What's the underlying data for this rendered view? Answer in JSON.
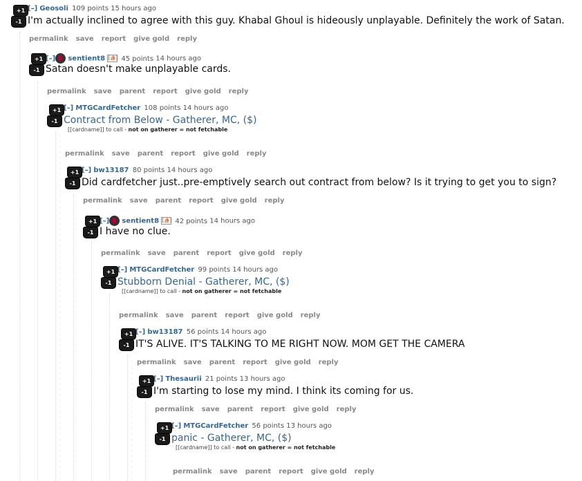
{
  "comments": [
    {
      "collapse": "[–]",
      "author": "Geosoli",
      "score": "109 points",
      "time": "15 hours ago",
      "body": "I'm actually inclined to agree with this guy. Khabal Ghoul is hideously unplayable. Definitely the work of Satan.",
      "buttons": [
        "permalink",
        "save",
        "report",
        "give gold",
        "reply"
      ]
    },
    {
      "collapse": "[–]",
      "author": "sentient8",
      "flair": "[⛵]",
      "score": "45 points",
      "time": "14 hours ago",
      "body": "Satan doesn't make unplayable cards.",
      "buttons": [
        "permalink",
        "save",
        "parent",
        "report",
        "give gold",
        "reply"
      ]
    },
    {
      "collapse": "[–]",
      "author": "MTGCardFetcher",
      "score": "108 points",
      "time": "14 hours ago",
      "card": "Contract from Below - Gatherer, MC, ($)",
      "footnote_a": "[[cardname]] to call - ",
      "footnote_b": "not on gatherer = not fetchable",
      "buttons": [
        "permalink",
        "save",
        "parent",
        "report",
        "give gold",
        "reply"
      ]
    },
    {
      "collapse": "[–]",
      "author": "bw13187",
      "score": "80 points",
      "time": "14 hours ago",
      "body": "Did cardfetcher just..pre-emptively search out contract from below? Is it trying to get you to sign?",
      "buttons": [
        "permalink",
        "save",
        "parent",
        "report",
        "give gold",
        "reply"
      ]
    },
    {
      "collapse": "[–]",
      "author": "sentient8",
      "flair": "[⛵]",
      "score": "42 points",
      "time": "14 hours ago",
      "body": "I have no clue.",
      "buttons": [
        "permalink",
        "save",
        "parent",
        "report",
        "give gold",
        "reply"
      ]
    },
    {
      "collapse": "[–]",
      "author": "MTGCardFetcher",
      "score": "99 points",
      "time": "14 hours ago",
      "card": "Stubborn Denial - Gatherer, MC, ($)",
      "footnote_a": "[[cardname]] to call - ",
      "footnote_b": "not on gatherer = not fetchable",
      "buttons": [
        "permalink",
        "save",
        "parent",
        "report",
        "give gold",
        "reply"
      ]
    },
    {
      "collapse": "[–]",
      "author": "bw13187",
      "score": "56 points",
      "time": "14 hours ago",
      "body": "IT'S ALIVE. IT'S TALKING TO ME RIGHT NOW. MOM GET THE CAMERA",
      "buttons": [
        "permalink",
        "save",
        "parent",
        "report",
        "give gold",
        "reply"
      ]
    },
    {
      "collapse": "[–]",
      "author": "Thesaurii",
      "score": "21 points",
      "time": "13 hours ago",
      "body": "I'm starting to lose my mind. I think its coming for us.",
      "buttons": [
        "permalink",
        "save",
        "parent",
        "report",
        "give gold",
        "reply"
      ]
    },
    {
      "collapse": "[–]",
      "author": "MTGCardFetcher",
      "score": "56 points",
      "time": "13 hours ago",
      "card": "panic - Gatherer, MC, ($)",
      "footnote_a": "[[cardname]] to call - ",
      "footnote_b": "not on gatherer = not fetchable",
      "buttons": [
        "permalink",
        "save",
        "parent",
        "report",
        "give gold",
        "reply"
      ]
    }
  ],
  "vote": {
    "up": "+1",
    "down": "-1"
  }
}
